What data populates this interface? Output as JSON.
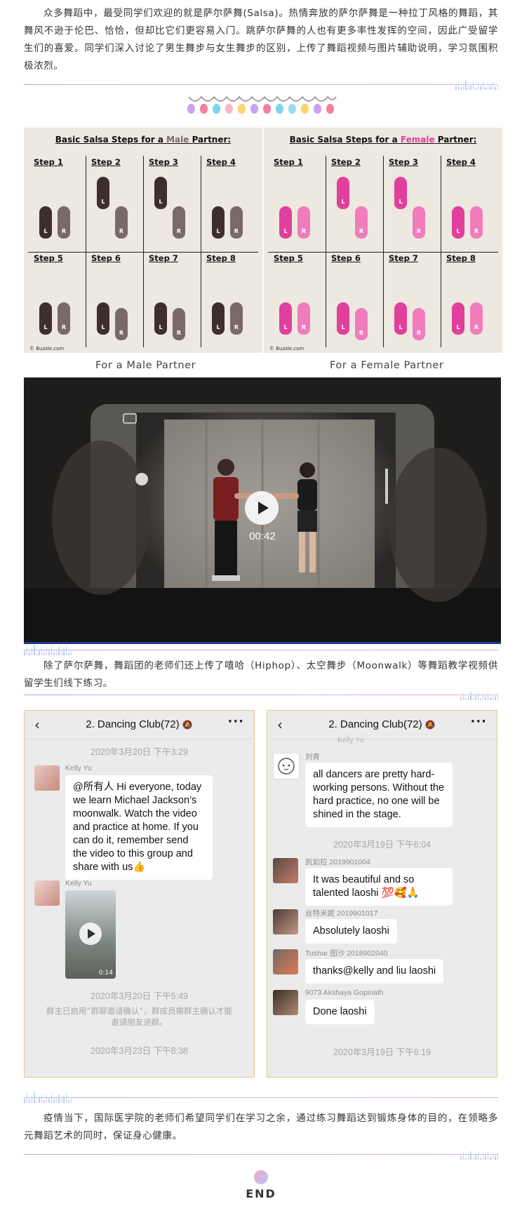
{
  "paragraphs": {
    "p1": "众多舞蹈中，最受同学们欢迎的就是萨尔萨舞(Salsa)。热情奔放的萨尔萨舞是一种拉丁风格的舞蹈，其舞风不逊于伦巴、恰恰，但却比它们更容易入门。跳萨尔萨舞的人也有更多率性发挥的空间，因此广受留学生们的喜爱。同学们深入讨论了男生舞步与女生舞步的区别，上传了舞蹈视频与图片辅助说明，学习氛围积极浓烈。",
    "p2": "除了萨尔萨舞，舞蹈团的老师们还上传了嘻哈（Hiphop）、太空舞步（Moonwalk）等舞蹈教学视频供留学生们线下练习。",
    "p3": "疫情当下，国际医学院的老师们希望同学们在学习之余，通过练习舞蹈达到锻炼身体的目的，在领略多元舞蹈艺术的同时，保证身心健康。"
  },
  "steps_images": {
    "male": {
      "title_pre": "Basic Salsa Steps for a ",
      "title_hl": "Male",
      "title_post": " Partner:",
      "steps": [
        "Step 1",
        "Step 2",
        "Step 3",
        "Step 4",
        "Step 5",
        "Step 6",
        "Step 7",
        "Step 8"
      ],
      "credit": "© Buzzle.com",
      "caption": "For a Male Partner"
    },
    "female": {
      "title_pre": "Basic Salsa Steps for a ",
      "title_hl": "Female",
      "title_post": " Partner:",
      "steps": [
        "Step 1",
        "Step 2",
        "Step 3",
        "Step 4",
        "Step 5",
        "Step 6",
        "Step 7",
        "Step 8"
      ],
      "credit": "© Buzzle.com",
      "caption": "For a Female Partner"
    },
    "foot_left": "L",
    "foot_right": "R",
    "watermark": "BUZZLE.COM"
  },
  "video": {
    "duration": "00:42"
  },
  "chat_left": {
    "title": "2. Dancing Club(72)",
    "back_icon": "‹",
    "more_icon": "···",
    "ts1": "2020年3月20日 下午3:29",
    "msg1_name": "Kelly Yu",
    "msg1_text": "@所有人 Hi everyone, today we learn Michael Jackson’s moonwalk. Watch the video and practice at home. If you can do it, remember send the video to this group and share with us👍",
    "msg2_name": "Kelly Yu",
    "msg2_duration": "0:14",
    "ts2": "2020年3月20日 下午5:49",
    "system": "群主已启用“群聊邀请确认”，群成员需群主确认才能邀请朋友进群。",
    "ts3": "2020年3月23日 下午8:38"
  },
  "chat_right": {
    "title": "2. Dancing Club(72)",
    "back_icon": "‹",
    "more_icon": "···",
    "top_cut": "Kelly Yu",
    "msg1_name": "刘青",
    "msg1_text": "all dancers are pretty hard-working persons. Without the hard practice, no one will be shined in the stage.",
    "ts1": "2020年3月19日 下午6:04",
    "msg2_name": "凯如拉 2019901004",
    "msg2_text": "It was beautiful and so talented laoshi 💯🥰🙏",
    "msg3_name": "丝特米妮 2019901017",
    "msg3_text": "Absolutely laoshi",
    "msg4_name": "Tushar 图沙 2018902040",
    "msg4_text": "thanks@kelly and liu laoshi",
    "msg5_name": "9073 Akshaya Gopinath",
    "msg5_text": "Done laoshi",
    "ts2": "2020年3月19日 下午6:19"
  },
  "end_label": "END",
  "colors": {
    "male_shoe_dark": "#3d2f2c",
    "male_shoe_light": "#7a6a65",
    "female_shoe_dark": "#e0409b",
    "female_shoe_light": "#f07cbd",
    "female_highlight": "#e0409b",
    "male_highlight": "#7a6a65",
    "chat_border": "#e8c78e"
  }
}
